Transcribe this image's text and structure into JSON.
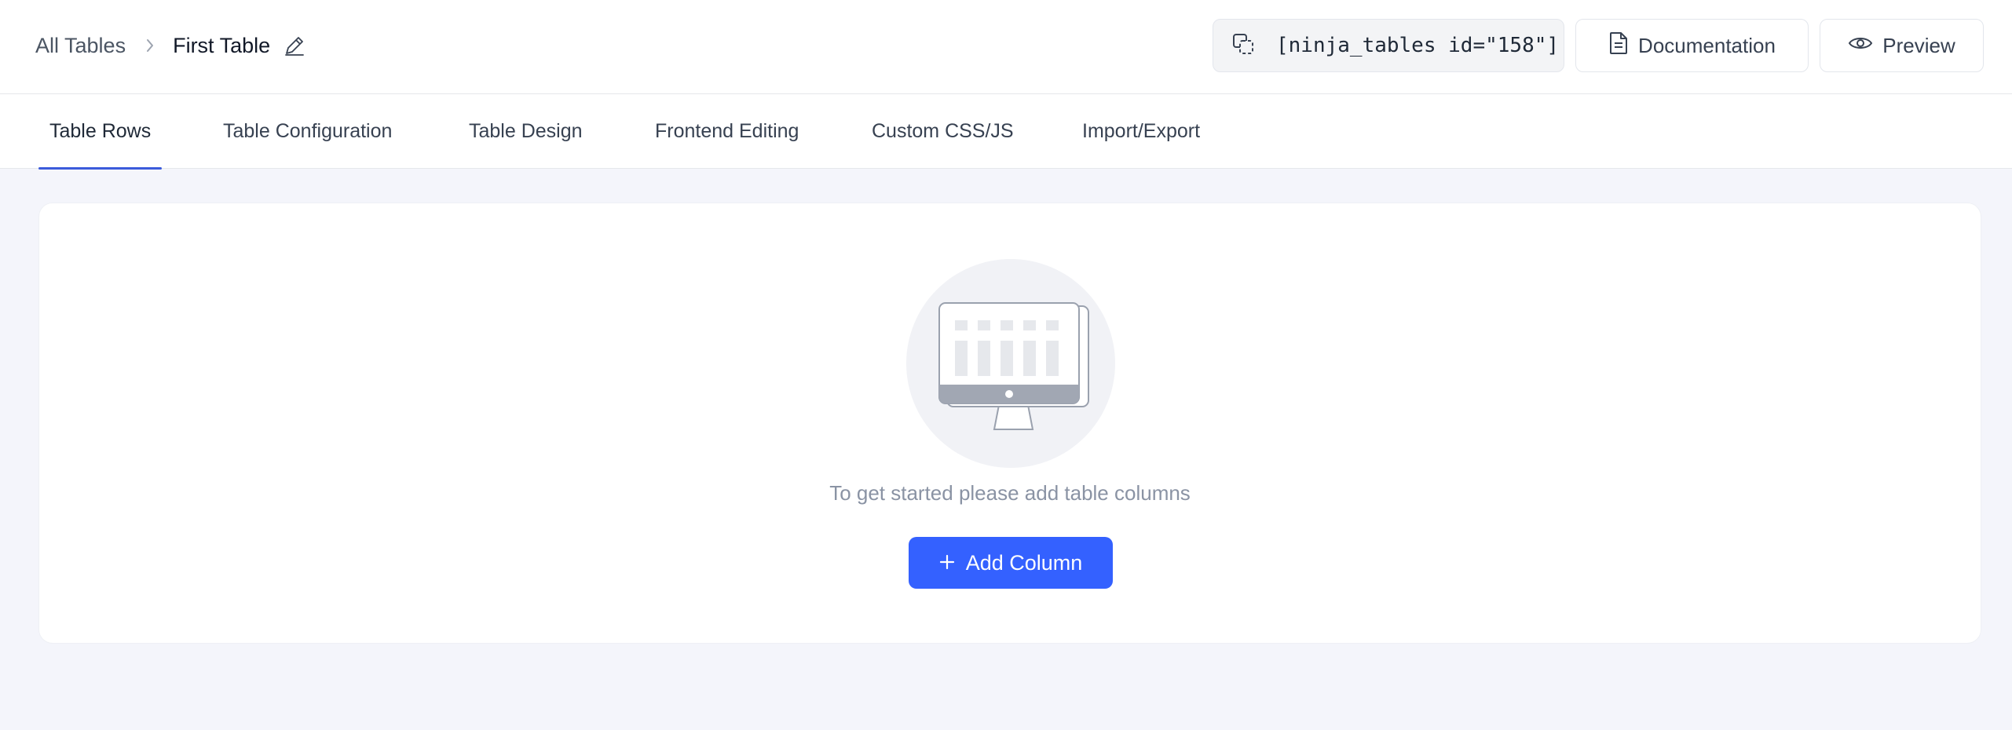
{
  "breadcrumb": {
    "root": "All Tables",
    "current": "First Table"
  },
  "header": {
    "shortcode": "[ninja_tables id=\"158\"]",
    "documentation_label": "Documentation",
    "preview_label": "Preview"
  },
  "tabs": [
    {
      "label": "Table Rows",
      "active": true
    },
    {
      "label": "Table Configuration",
      "active": false
    },
    {
      "label": "Table Design",
      "active": false
    },
    {
      "label": "Frontend Editing",
      "active": false
    },
    {
      "label": "Custom CSS/JS",
      "active": false
    },
    {
      "label": "Import/Export",
      "active": false
    }
  ],
  "empty_state": {
    "illustration": "monitor-table-icon",
    "message": "To get started please add table columns",
    "add_column_label": "Add Column"
  },
  "colors": {
    "accent": "#3461ff",
    "active_tab_underline": "#3b5bdb",
    "page_background": "#f4f5fb"
  }
}
